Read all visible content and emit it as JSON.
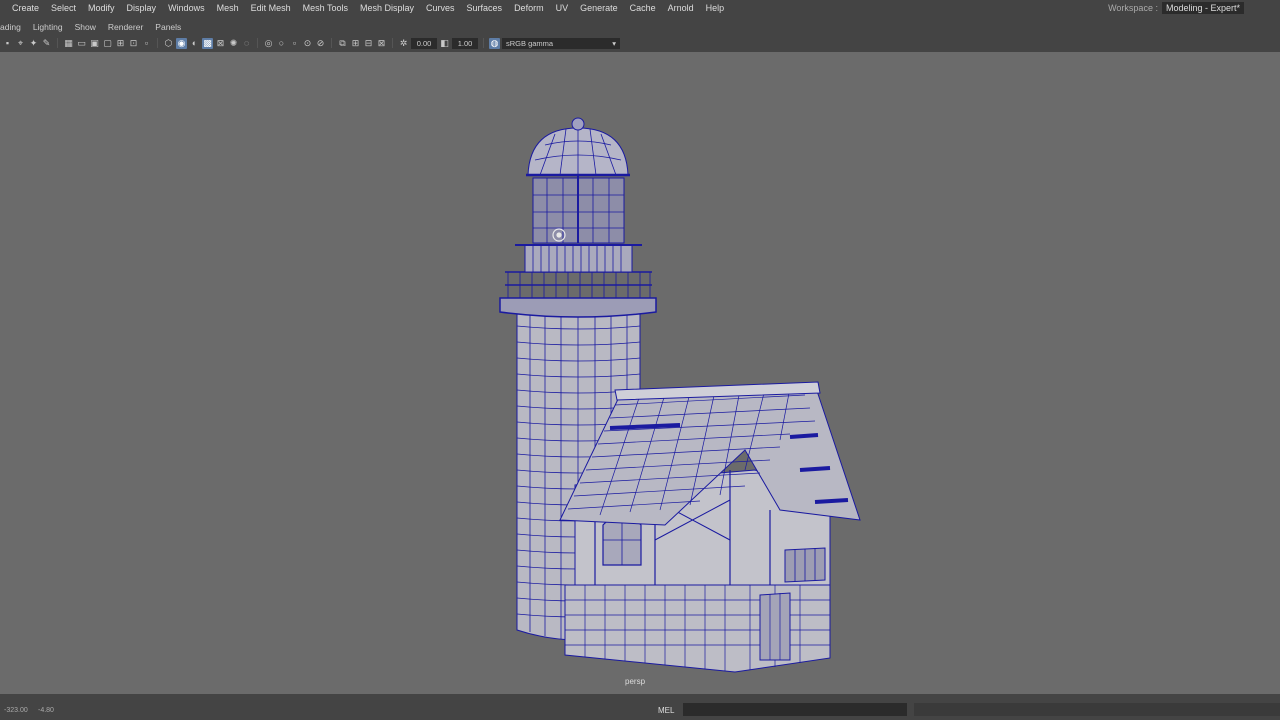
{
  "menubar": {
    "items": [
      "Create",
      "Select",
      "Modify",
      "Display",
      "Windows",
      "Mesh",
      "Edit Mesh",
      "Mesh Tools",
      "Mesh Display",
      "Curves",
      "Surfaces",
      "Deform",
      "UV",
      "Generate",
      "Cache",
      "Arnold",
      "Help"
    ],
    "workspace_label": "Workspace :",
    "workspace_value": "Modeling - Expert*"
  },
  "panel_menu": {
    "items": [
      "ading",
      "Lighting",
      "Show",
      "Renderer",
      "Panels"
    ]
  },
  "panel_toolbar": {
    "exposure": "0.00",
    "gamma": "1.00",
    "color_space": "sRGB gamma"
  },
  "viewport": {
    "camera": "persp",
    "background": "#6b6b6b",
    "wire_color": "#1a1aa0"
  },
  "statusbar": {
    "coord_x": "-323.00",
    "coord_y": "-4.80",
    "mel_label": "MEL"
  }
}
